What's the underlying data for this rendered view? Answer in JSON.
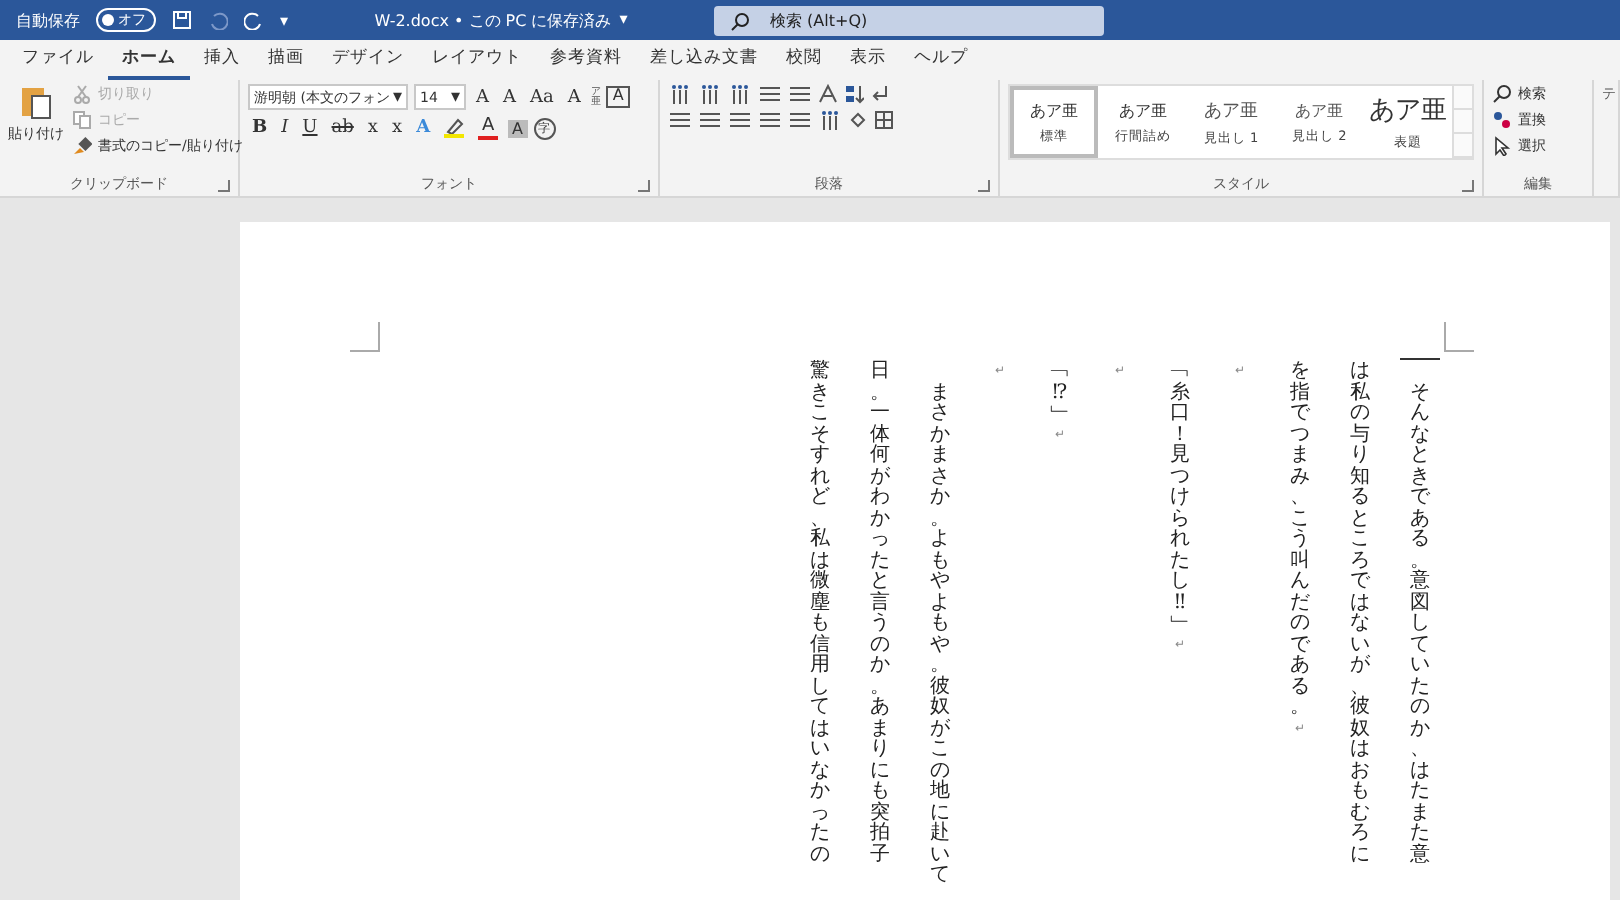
{
  "title_bar": {
    "autosave_label": "自動保存",
    "autosave_on": false,
    "autosave_state": "オフ",
    "customize_caret": "▾",
    "document_title": "W-2.docx • この PC に保存済み",
    "title_caret": "▾",
    "search_placeholder": "検索 (Alt+Q)"
  },
  "tabs": [
    {
      "label": "ファイル",
      "selected": false
    },
    {
      "label": "ホーム",
      "selected": true
    },
    {
      "label": "挿入",
      "selected": false
    },
    {
      "label": "描画",
      "selected": false
    },
    {
      "label": "デザイン",
      "selected": false
    },
    {
      "label": "レイアウト",
      "selected": false
    },
    {
      "label": "参考資料",
      "selected": false
    },
    {
      "label": "差し込み文書",
      "selected": false
    },
    {
      "label": "校閲",
      "selected": false
    },
    {
      "label": "表示",
      "selected": false
    },
    {
      "label": "ヘルプ",
      "selected": false
    }
  ],
  "clipboard": {
    "label": "クリップボード",
    "paste": "貼り付け",
    "items": [
      {
        "label": "切り取り",
        "disabled": true,
        "kind": "cut"
      },
      {
        "label": "コピー",
        "disabled": true,
        "kind": "copy"
      },
      {
        "label": "書式のコピー/貼り付け",
        "disabled": false,
        "kind": "brush"
      }
    ]
  },
  "font": {
    "label": "フォント",
    "font_name": "游明朝 (本文のフォン",
    "font_size": "14",
    "dropdown_caret": "▾",
    "grow": "A",
    "shrink": "A",
    "case": "Aa",
    "clear": "A",
    "phonetic_top": "ア",
    "phonetic_bottom": "亜",
    "border_char": "A",
    "bold": "B",
    "italic": "I",
    "underline": "U",
    "strike": "ab",
    "subscript": "x",
    "superscript": "x",
    "effects": "A",
    "font_color_char": "A",
    "shading": "A",
    "enclosed": "字"
  },
  "paragraph": {
    "label": "段落"
  },
  "styles": {
    "label": "スタイル",
    "items": [
      {
        "preview": "あア亜",
        "name": "標準",
        "selected": true,
        "kind": "normal"
      },
      {
        "preview": "あア亜",
        "name": "行間詰め",
        "selected": false,
        "kind": "normal"
      },
      {
        "preview": "あア亜",
        "name": "見出し 1",
        "selected": false,
        "kind": "heading"
      },
      {
        "preview": "あア亜",
        "name": "見出し 2",
        "selected": false,
        "kind": "small"
      },
      {
        "preview": "あア亜",
        "name": "表題",
        "selected": false,
        "kind": "title"
      }
    ]
  },
  "editing": {
    "label": "編集",
    "items": [
      {
        "label": "検索",
        "kind": "find"
      },
      {
        "label": "置換",
        "kind": "replace"
      },
      {
        "label": "選択",
        "kind": "select"
      }
    ]
  },
  "next_group_label": "テ",
  "document": {
    "paragraph_mark": "↵",
    "columns": [
      {
        "text": "驚きこそすれど、私は微塵も信用してはいなかったの",
        "indented": false,
        "end_mark": false
      },
      {
        "text": "日。一体何がわかったと言うのか。あまりにも突拍子",
        "indented": false,
        "end_mark": false
      },
      {
        "text": "まさかまさか。よもやよもや。彼奴がこの地に赴いて",
        "indented": true,
        "end_mark": false
      },
      {
        "text": "",
        "indented": false,
        "end_mark": true
      },
      {
        "text": "﹁⁉﹂",
        "indented": false,
        "end_mark": true
      },
      {
        "text": "",
        "indented": false,
        "end_mark": true
      },
      {
        "text": "﹁糸口！見つけられたし‼﹂",
        "indented": false,
        "end_mark": true
      },
      {
        "text": "",
        "indented": false,
        "end_mark": true
      },
      {
        "text": "を指でつまみ、こう叫んだのである。",
        "indented": false,
        "end_mark": true
      },
      {
        "text": "は私の与り知るところではないが、彼奴はおもむろに",
        "indented": false,
        "end_mark": false
      },
      {
        "text": "そんなときである。意図していたのか、はたまた意",
        "indented": true,
        "end_mark": false
      }
    ]
  }
}
